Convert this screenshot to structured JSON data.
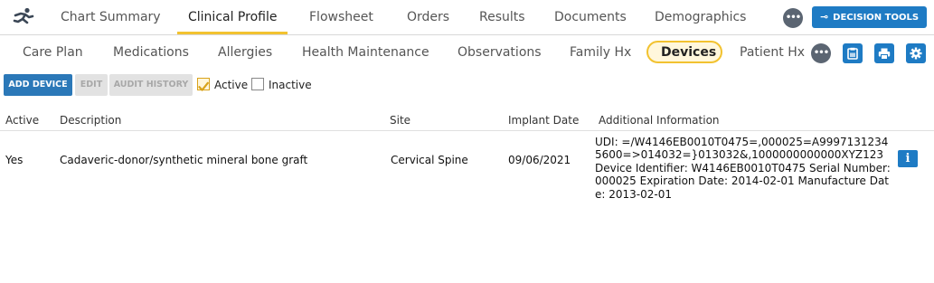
{
  "top_nav": {
    "tabs": [
      {
        "label": "Chart Summary"
      },
      {
        "label": "Clinical Profile",
        "active": true
      },
      {
        "label": "Flowsheet"
      },
      {
        "label": "Orders"
      },
      {
        "label": "Results"
      },
      {
        "label": "Documents"
      },
      {
        "label": "Demographics"
      }
    ],
    "more_icon": "ellipsis-icon",
    "decision_tools_label": "DECISION TOOLS"
  },
  "sub_nav": {
    "tabs": [
      {
        "label": "Care Plan"
      },
      {
        "label": "Medications"
      },
      {
        "label": "Allergies"
      },
      {
        "label": "Health Maintenance"
      },
      {
        "label": "Observations"
      },
      {
        "label": "Family Hx"
      },
      {
        "label": "Devices",
        "active": true
      },
      {
        "label": "Patient Hx"
      }
    ],
    "action_icons": [
      "clipboard-icon",
      "print-icon",
      "gear-icon"
    ]
  },
  "toolbar": {
    "add_label": "ADD DEVICE",
    "edit_label": "EDIT",
    "audit_label": "AUDIT HISTORY",
    "active_label": "Active",
    "active_checked": true,
    "inactive_label": "Inactive",
    "inactive_checked": false
  },
  "table": {
    "headers": [
      "Active",
      "Description",
      "Site",
      "Implant Date",
      "Additional Information"
    ],
    "rows": [
      {
        "active": "Yes",
        "description": "Cadaveric-donor/synthetic mineral bone graft",
        "site": "Cervical Spine",
        "implant_date": "09/06/2021",
        "additional_info": " UDI: =/W4146EB0010T0475=,000025=A99971312345600=>014032=}013032&,1000000000000XYZ123 Device Identifier: W4146EB0010T0475 Serial Number: 000025 Expiration Date: 2014-02-01 Manufacture Date: 2013-02-01"
      }
    ]
  },
  "colors": {
    "accent": "#f2c230",
    "primary": "#1e7bc4",
    "dark_circle": "#5b6572"
  }
}
